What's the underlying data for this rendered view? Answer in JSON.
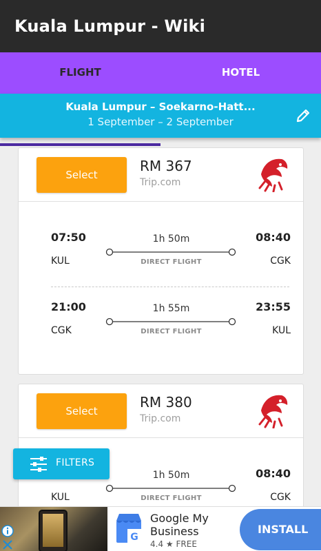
{
  "app": {
    "title": "Kuala Lumpur - Wiki"
  },
  "tabs": [
    {
      "label": "FLIGHT",
      "active": true
    },
    {
      "label": "HOTEL",
      "active": false
    }
  ],
  "search": {
    "route": "Kuala Lumpur – Soekarno-Hatt...",
    "dates": "1 September – 2 September"
  },
  "results": [
    {
      "select_label": "Select",
      "price": "RM 367",
      "provider": "Trip.com",
      "airline_logo": "lion-air-logo",
      "legs": [
        {
          "dep_time": "07:50",
          "dep_code": "KUL",
          "duration": "1h 50m",
          "stops": "DIRECT FLIGHT",
          "arr_time": "08:40",
          "arr_code": "CGK"
        },
        {
          "dep_time": "21:00",
          "dep_code": "CGK",
          "duration": "1h 55m",
          "stops": "DIRECT FLIGHT",
          "arr_time": "23:55",
          "arr_code": "KUL"
        }
      ]
    },
    {
      "select_label": "Select",
      "price": "RM 380",
      "provider": "Trip.com",
      "airline_logo": "lion-air-logo",
      "legs": [
        {
          "dep_code": "KUL",
          "duration": "1h 50m",
          "stops": "DIRECT FLIGHT",
          "arr_time": "08:40",
          "arr_code": "CGK"
        }
      ]
    }
  ],
  "filters": {
    "label": "FILTERS",
    "icon": "sliders-icon"
  },
  "ad": {
    "title": "Google My Business",
    "rating": "4.4",
    "price": "FREE",
    "install_label": "INSTALL"
  },
  "colors": {
    "app_bar": "#2a2a2a",
    "tab_bar": "#9c4dff",
    "route_bar": "#13b4e0",
    "select_button": "#fca20e",
    "install_button": "#4a86e0"
  }
}
